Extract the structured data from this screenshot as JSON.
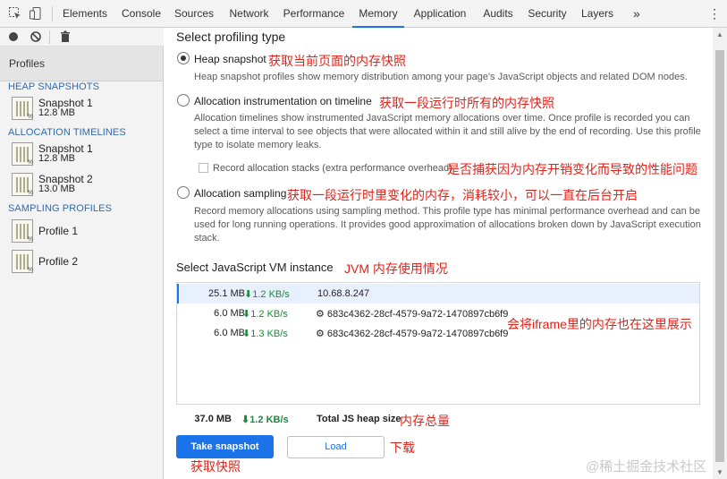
{
  "tabs": [
    {
      "label": "Elements"
    },
    {
      "label": "Console"
    },
    {
      "label": "Sources"
    },
    {
      "label": "Network"
    },
    {
      "label": "Performance"
    },
    {
      "label": "Memory"
    },
    {
      "label": "Application"
    },
    {
      "label": "Audits"
    },
    {
      "label": "Security"
    },
    {
      "label": "Layers"
    }
  ],
  "active_tab": "Memory",
  "more_tabs_glyph": "»",
  "menu_glyph": "⋮",
  "toolbar_icons": [
    "inspect-icon",
    "device-toggle-icon",
    "record-icon",
    "clear-icon",
    "trash-icon"
  ],
  "sidebar": {
    "header": "Profiles",
    "groups": [
      {
        "title": "HEAP SNAPSHOTS",
        "items": [
          {
            "name": "Snapshot 1",
            "size": "12.8 MB"
          }
        ]
      },
      {
        "title": "ALLOCATION TIMELINES",
        "items": [
          {
            "name": "Snapshot 1",
            "size": "12.8 MB"
          },
          {
            "name": "Snapshot 2",
            "size": "13.0 MB"
          }
        ]
      },
      {
        "title": "SAMPLING PROFILES",
        "items": [
          {
            "name": "Profile 1"
          },
          {
            "name": "Profile 2"
          }
        ]
      }
    ]
  },
  "main": {
    "title": "Select profiling type",
    "options": [
      {
        "label": "Heap snapshot",
        "selected": true,
        "annotation": "获取当前页面的内存快照",
        "description": "Heap snapshot profiles show memory distribution among your page's JavaScript objects and related DOM nodes."
      },
      {
        "label": "Allocation instrumentation on timeline",
        "selected": false,
        "annotation": "获取一段运行时所有的内存快照",
        "description": "Allocation timelines show instrumented JavaScript memory allocations over time. Once profile is recorded you can select a time interval to see objects that were allocated within it and still alive by the end of recording. Use this profile type to isolate memory leaks.",
        "checkbox_label": "Record allocation stacks (extra performance overhead)",
        "checkbox_checked": false,
        "checkbox_annotation": "是否捕获因为内存开销变化而导致的性能问题"
      },
      {
        "label": "Allocation sampling",
        "selected": false,
        "annotation": "获取一段运行时里变化的内存，消耗较小，可以一直在后台开启",
        "description": "Record memory allocations using sampling method. This profile type has minimal performance overhead and can be used for long running operations. It provides good approximation of allocations broken down by JavaScript execution stack."
      }
    ],
    "vm": {
      "title": "Select JavaScript VM instance",
      "annotation": "JVM 内存使用情况",
      "rows": [
        {
          "size": "25.1 MB",
          "rate": "⬇1.2 KB/s",
          "name": "10.68.8.247",
          "selected": true
        },
        {
          "size": "6.0 MB",
          "rate": "⬇1.2 KB/s",
          "name": "⚙ 683c4362-28cf-4579-9a72-1470897cb6f9",
          "selected": false
        },
        {
          "size": "6.0 MB",
          "rate": "⬇1.3 KB/s",
          "name": "⚙ 683c4362-28cf-4579-9a72-1470897cb6f9",
          "selected": false
        }
      ],
      "rows_annotation": "会将iframe里的内存也在这里展示",
      "total_size": "37.0 MB",
      "total_rate": "⬇1.2 KB/s",
      "total_label": "Total JS heap size",
      "total_annotation": "内存总量"
    },
    "take_snapshot_label": "Take snapshot",
    "take_snapshot_annotation": "获取快照",
    "load_label": "Load",
    "load_annotation": "下载"
  },
  "watermark": "@稀土掘金技术社区",
  "colors": {
    "accent": "#1a73e8",
    "annotation": "#e2231a",
    "group_title": "#2f6aae",
    "rate": "#1b8a3c"
  }
}
